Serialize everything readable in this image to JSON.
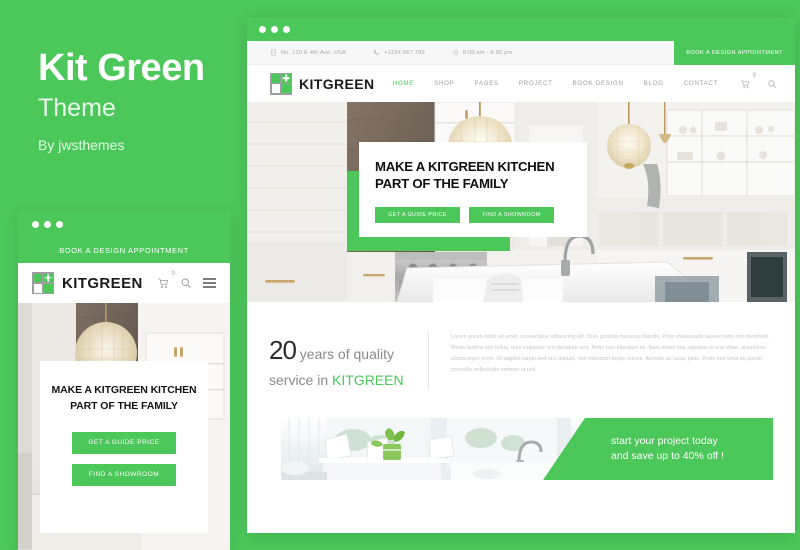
{
  "promo": {
    "title": "Kit Green",
    "subtitle": "Theme",
    "author": "By jwsthemes",
    "brand_color": "#4cc75a"
  },
  "site": {
    "logo_text": "KITGREEN",
    "topbar": {
      "address": "No. 120 E 4th Ave, USA",
      "phone": "+1234 567 789",
      "hours": "8:00 am - 6:00 pm",
      "appointment_label": "BOOK A DESIGN APPOINTMENT"
    },
    "nav": [
      {
        "label": "HOME",
        "active": true
      },
      {
        "label": "SHOP",
        "active": false
      },
      {
        "label": "PAGES",
        "active": false
      },
      {
        "label": "PROJECT",
        "active": false
      },
      {
        "label": "BOOK DESIGN",
        "active": false
      },
      {
        "label": "BLOG",
        "active": false
      },
      {
        "label": "CONTACT",
        "active": false
      }
    ],
    "cart_count": "0",
    "hero": {
      "heading_line1": "MAKE A KITGREEN KITCHEN",
      "heading_line2": "PART OF THE FAMILY",
      "button_primary": "GET A GUIDE PRICE",
      "button_secondary": "FIND A SHOWROOM"
    },
    "about": {
      "number": "20",
      "after_number": " years of quality",
      "line2_prefix": "service in ",
      "line2_brand": "KITGREEN",
      "paragraph": "Lorem ipsum dolor sit amet, consectetur adipiscing elit. Duis gravida maximus blandit. Proin malesuada laoreet odio non hendrerit. Morbi viverra orci tellus, quis vulputate orci tincidunt sed. Proin non interdum mi. Nam lorem nisi, egestas in erat vitae, accumsan ullamcorper enim. Ut sagittis turpis sed orci aliquet, non interdum turpis rutrum. Aenean ac lacus justo. Proin sed urna eu ipsum convallis sollicitudin semper ut nisl."
    },
    "banner": {
      "line1": "start your project today",
      "line2": "and save up to 40% off !"
    }
  },
  "icons": {
    "address": "building-icon",
    "phone": "phone-icon",
    "clock": "clock-icon",
    "cart": "cart-icon",
    "search": "search-icon",
    "menu": "hamburger-icon"
  }
}
